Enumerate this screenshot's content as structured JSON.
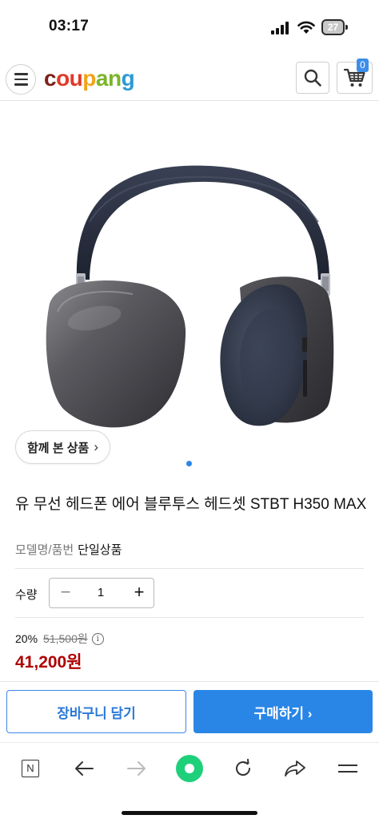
{
  "status_bar": {
    "time": "03:17",
    "battery": "27"
  },
  "header": {
    "logo_parts": [
      "c",
      "ou",
      "p",
      "an",
      "g"
    ],
    "cart_count": "0",
    "icons": [
      "menu-icon",
      "search-icon",
      "cart-icon"
    ]
  },
  "gallery": {
    "together_label": "함께 본 상품",
    "together_chevron": "›"
  },
  "product": {
    "title": "유 무선 헤드폰 에어 블루투스 헤드셋 STBT H350 MAX",
    "model_label": "모델명/품번",
    "model_value": "단일상품",
    "quantity_label": "수량",
    "quantity_value": "1",
    "discount": "20%",
    "original_price": "51,500원",
    "sale_price": "41,200원"
  },
  "actions": {
    "cart_label": "장바구니 담기",
    "buy_label": "구매하기 ›"
  },
  "browser_toolbar": {
    "tab_label": "N",
    "icons": [
      "tab-icon",
      "back-icon",
      "forward-icon",
      "home-icon",
      "refresh-icon",
      "share-icon",
      "menu-icon"
    ]
  },
  "colors": {
    "accent": "#2a86e6",
    "price": "#ae0000"
  }
}
